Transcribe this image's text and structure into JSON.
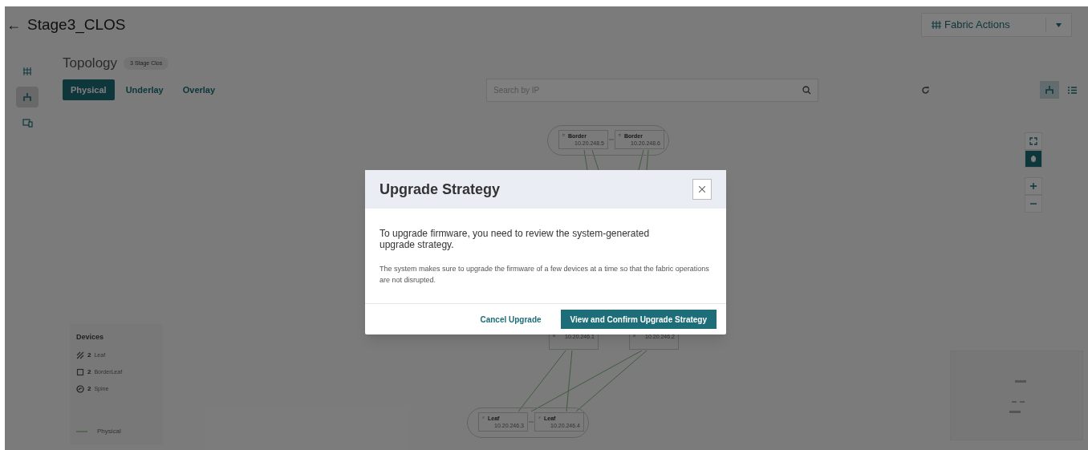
{
  "header": {
    "back_icon": "←",
    "title": "Stage3_CLOS",
    "actions_button": "Fabric Actions"
  },
  "sidebar": {
    "items": [
      {
        "kind": "fabric",
        "selected": false
      },
      {
        "kind": "topology",
        "selected": true
      },
      {
        "kind": "devices",
        "selected": false
      }
    ]
  },
  "topology": {
    "title": "Topology",
    "badge": "3 Stage Clos",
    "tabs": [
      {
        "label": "Physical",
        "selected": true
      },
      {
        "label": "Underlay",
        "selected": false
      },
      {
        "label": "Overlay",
        "selected": false
      }
    ],
    "search": {
      "placeholder": "Search by IP"
    },
    "view_toggle": [
      {
        "kind": "graph",
        "selected": true
      },
      {
        "kind": "list",
        "selected": false
      }
    ],
    "map_controls": [
      {
        "kind": "fit",
        "selected": false
      },
      {
        "kind": "pan",
        "selected": true
      },
      {
        "kind": "zoom-in",
        "selected": false
      },
      {
        "kind": "zoom-out",
        "selected": false
      }
    ]
  },
  "diagram": {
    "nodes": [
      {
        "kind": "border",
        "label": "Border",
        "ip": "10.20.248.5"
      },
      {
        "kind": "border",
        "label": "Border",
        "ip": "10.20.248.6"
      },
      {
        "kind": "spine",
        "ip": "10.20.246.1"
      },
      {
        "kind": "spine",
        "ip": "10.20.246.2"
      },
      {
        "kind": "leaf",
        "label": "Leaf",
        "ip": "10.20.246.3"
      },
      {
        "kind": "leaf",
        "label": "Leaf",
        "ip": "10.20.246.4"
      }
    ]
  },
  "legend": {
    "title": "Devices",
    "items": [
      {
        "kind": "leaf",
        "count": "2",
        "label": "Leaf"
      },
      {
        "kind": "border",
        "count": "2",
        "label": "BorderLeaf"
      },
      {
        "kind": "spine",
        "count": "2",
        "label": "Spine"
      }
    ],
    "links": [
      {
        "label": "Physical"
      }
    ]
  },
  "modal": {
    "title": "Upgrade Strategy",
    "lead": "To upgrade firmware, you need to review the system-generated upgrade strategy.",
    "note": "The system makes sure to upgrade the firmware of a few devices at a time so that the fabric operations are not disrupted.",
    "buttons": [
      {
        "kind": "secondary",
        "label": "Cancel Upgrade"
      },
      {
        "kind": "primary",
        "label": "View and Confirm Upgrade Strategy"
      }
    ]
  }
}
